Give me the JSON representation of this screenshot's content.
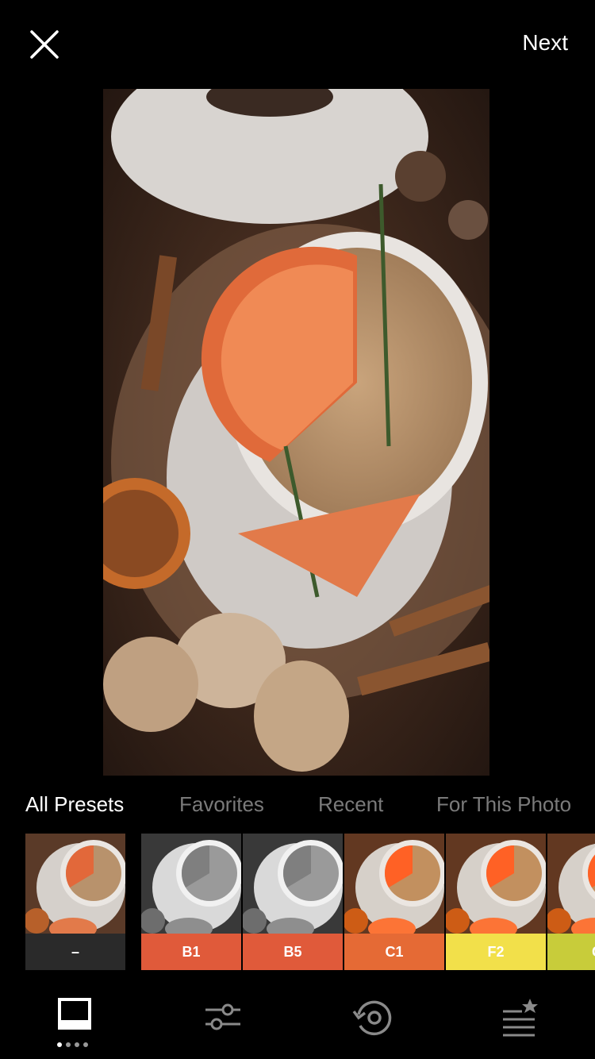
{
  "header": {
    "close_icon": "close-icon",
    "next_label": "Next"
  },
  "tabs": [
    {
      "label": "All Presets",
      "active": true
    },
    {
      "label": "Favorites",
      "active": false
    },
    {
      "label": "Recent",
      "active": false
    },
    {
      "label": "For This Photo",
      "active": false
    }
  ],
  "presets": [
    {
      "label": "–",
      "color": "#2a2a2a",
      "style": "original"
    },
    {
      "label": "B1",
      "color": "#e05a3a",
      "style": "bw"
    },
    {
      "label": "B5",
      "color": "#e05a3a",
      "style": "bw"
    },
    {
      "label": "C1",
      "color": "#e56a35",
      "style": "warm"
    },
    {
      "label": "F2",
      "color": "#f2e04a",
      "style": "warm"
    },
    {
      "label": "G",
      "color": "#c8cc3a",
      "style": "warm"
    }
  ],
  "toolbar": {
    "items": [
      {
        "name": "presets-icon",
        "active": true
      },
      {
        "name": "adjust-sliders-icon",
        "active": false
      },
      {
        "name": "history-icon",
        "active": false
      },
      {
        "name": "recipes-icon",
        "active": false
      }
    ]
  }
}
